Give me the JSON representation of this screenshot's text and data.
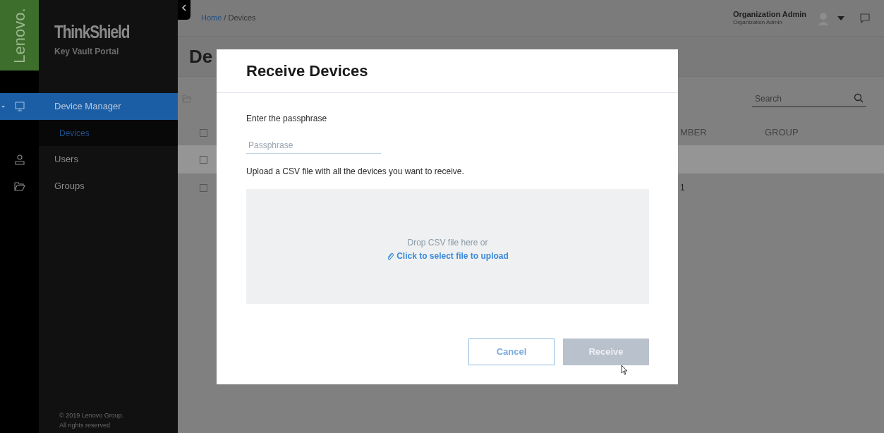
{
  "brand": {
    "vertical_logo": "Lenovo.",
    "name": "ThinkShield",
    "subtitle": "Key Vault Portal"
  },
  "sidebar": {
    "items": [
      {
        "label": "Device Manager",
        "selected": true,
        "expanded": true,
        "children": [
          {
            "label": "Devices",
            "selected": true
          }
        ]
      },
      {
        "label": "Users",
        "selected": false
      },
      {
        "label": "Groups",
        "selected": false
      }
    ],
    "footer": [
      "© 2019 Lenovo Group.",
      "All rights reserved"
    ]
  },
  "breadcrumb": [
    {
      "label": "Home",
      "kind": "link"
    },
    {
      "label": "/ Devices",
      "kind": "current"
    }
  ],
  "user": {
    "name": "Organization Admin",
    "role": "Organization Admin"
  },
  "page": {
    "title": "De",
    "search": {
      "placeholder": "Search"
    },
    "table": {
      "header_checked": false,
      "columns": [
        "MBER",
        "GROUP"
      ],
      "rows": [
        {
          "checked": false,
          "highlighted": true
        },
        {
          "checked": false,
          "highlighted": false,
          "cells": [
            "1"
          ]
        }
      ]
    }
  },
  "dialog": {
    "title": "Receive Devices",
    "passphrase_label": "Enter the passphrase",
    "passphrase": {
      "placeholder": "Passphrase"
    },
    "upload_text": "Upload a CSV file with all the devices you want to receive.",
    "dropzone": {
      "text": "Drop CSV file here or",
      "link": "Click to select file to upload"
    },
    "buttons": [
      {
        "label": "Cancel",
        "kind": "secondary",
        "disabled": false
      },
      {
        "label": "Receive",
        "kind": "primary",
        "disabled": true
      }
    ]
  }
}
